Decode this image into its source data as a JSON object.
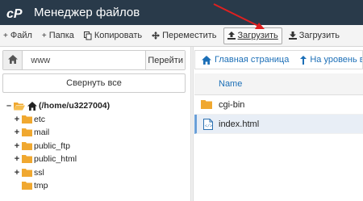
{
  "app": {
    "title": "Менеджер файлов",
    "logo_icon": "cpanel-logo-icon"
  },
  "toolbar": {
    "items": [
      {
        "label": "Файл",
        "icon": "plus-icon"
      },
      {
        "label": "Папка",
        "icon": "plus-icon"
      },
      {
        "label": "Копировать",
        "icon": "copy-icon"
      },
      {
        "label": "Переместить",
        "icon": "move-icon"
      },
      {
        "label": "Загрузить",
        "icon": "upload-icon",
        "active": true
      },
      {
        "label": "Загрузить",
        "icon": "download-icon"
      }
    ]
  },
  "left": {
    "path_value": "www",
    "go_label": "Перейти",
    "collapse_label": "Свернуть все",
    "tree": {
      "root": "(/home/u3227004)",
      "children": [
        {
          "label": "etc",
          "expandable": true
        },
        {
          "label": "mail",
          "expandable": true
        },
        {
          "label": "public_ftp",
          "expandable": true
        },
        {
          "label": "public_html",
          "expandable": true
        },
        {
          "label": "ssl",
          "expandable": true
        },
        {
          "label": "tmp",
          "expandable": false
        }
      ]
    }
  },
  "right": {
    "nav": {
      "home_label": "Главная страница",
      "up_label": "На уровень вы"
    },
    "table": {
      "header_name": "Name",
      "rows": [
        {
          "name": "cgi-bin",
          "type": "folder"
        },
        {
          "name": "index.html",
          "type": "html-file",
          "selected": true
        }
      ]
    }
  },
  "colors": {
    "header_bg": "#293a4a",
    "link": "#1c6fb7",
    "folder": "#f0a830",
    "arrow": "#e02020"
  }
}
